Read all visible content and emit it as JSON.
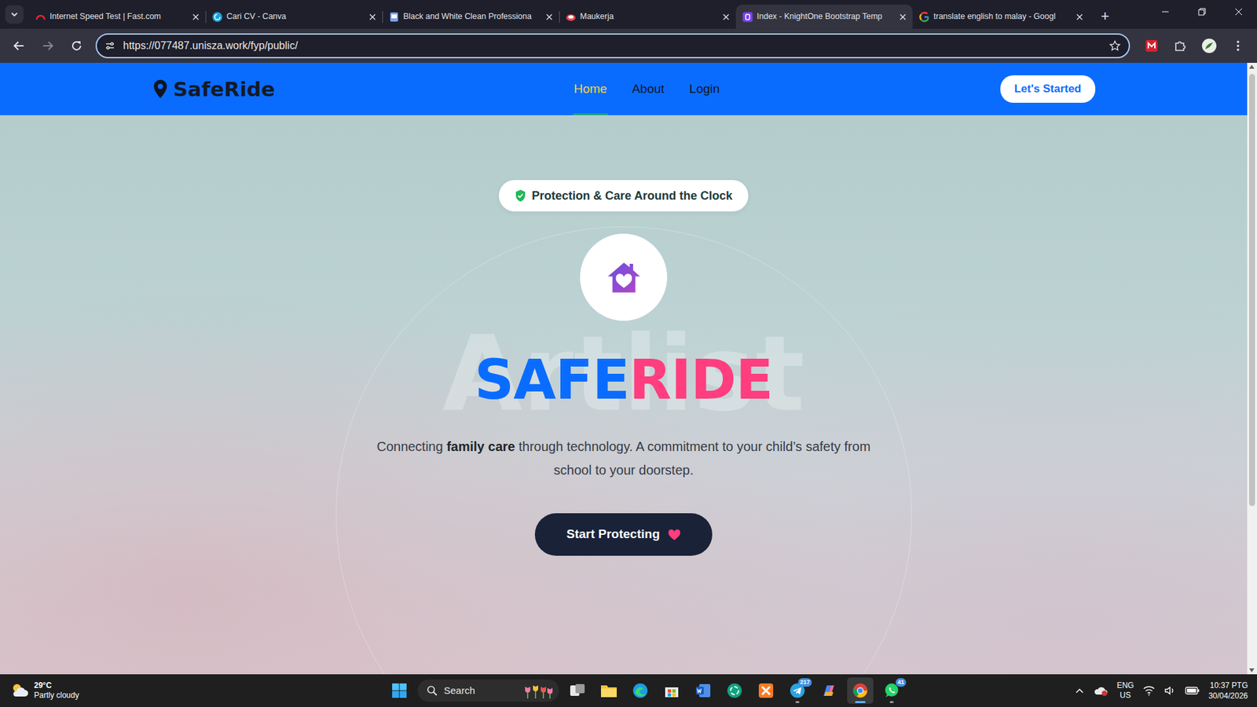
{
  "browser": {
    "tabs": [
      {
        "label": "Internet Speed Test | Fast.com",
        "selected": false
      },
      {
        "label": "Cari CV - Canva",
        "selected": false
      },
      {
        "label": "Black and White Clean Professiona",
        "selected": false
      },
      {
        "label": "Maukerja",
        "selected": false
      },
      {
        "label": "Index - KnightOne Bootstrap Temp",
        "selected": true
      },
      {
        "label": "translate english to malay - Googl",
        "selected": false
      }
    ],
    "new_tab": "+",
    "address": "https://077487.unisza.work/fyp/public/"
  },
  "page": {
    "brand": "SafeRide",
    "nav": [
      {
        "label": "Home",
        "selected": true
      },
      {
        "label": "About",
        "selected": false
      },
      {
        "label": "Login",
        "selected": false
      }
    ],
    "cta": "Let's Started",
    "hero": {
      "badge": "Protection & Care Around the Clock",
      "watermark": "Artlist",
      "title": [
        {
          "text": "SAFE",
          "color": "#0a6cff"
        },
        {
          "text": "RIDE",
          "color": "#ff3d7f"
        }
      ],
      "description": [
        {
          "text": "Connecting ",
          "bold": false
        },
        {
          "text": "family care",
          "bold": true
        },
        {
          "text": " through technology. A commitment to your child’s safety from school to your doorstep.",
          "bold": false
        }
      ],
      "button": "Start Protecting"
    }
  },
  "taskbar": {
    "weather": {
      "temp": "29°C",
      "condition": "Partly cloudy"
    },
    "search": {
      "label": "Search"
    },
    "apps": [
      {
        "running": false,
        "selected": false
      },
      {
        "running": false,
        "selected": false
      },
      {
        "running": false,
        "selected": false
      },
      {
        "running": false,
        "selected": false
      },
      {
        "running": false,
        "selected": false
      },
      {
        "running": false,
        "selected": false
      },
      {
        "running": false,
        "selected": false
      },
      {
        "running": true,
        "selected": false,
        "badge": "217"
      },
      {
        "running": false,
        "selected": false
      },
      {
        "running": true,
        "selected": true
      },
      {
        "running": true,
        "selected": false,
        "badge": "41"
      }
    ],
    "language": {
      "code": "ENG",
      "region": "US"
    },
    "clock": {
      "time": "10:37 PTG",
      "date": "30/04/2026"
    }
  }
}
